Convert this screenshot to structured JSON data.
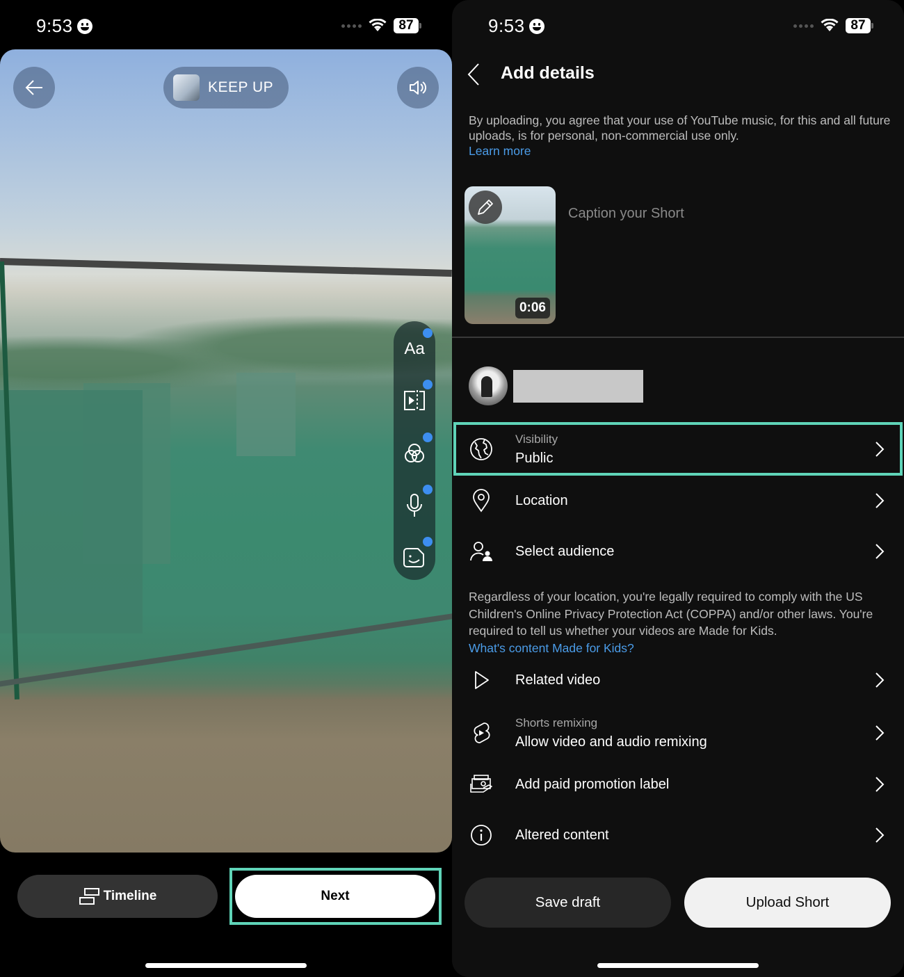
{
  "left_screen": {
    "status_bar": {
      "time": "9:53",
      "battery": "87"
    },
    "top_controls": {
      "back_icon": "arrow-left-icon",
      "music_track": "KEEP UP",
      "sound_icon": "speaker-icon"
    },
    "side_tools": [
      {
        "name": "text",
        "label": "Aa",
        "icon": "text-icon",
        "has_dot": true
      },
      {
        "name": "trim",
        "icon": "trim-icon",
        "has_dot": true
      },
      {
        "name": "filters",
        "icon": "filters-icon",
        "has_dot": true
      },
      {
        "name": "voiceover",
        "icon": "microphone-icon",
        "has_dot": true
      },
      {
        "name": "sticker",
        "icon": "sticker-icon",
        "has_dot": true
      }
    ],
    "bottom": {
      "timeline_label": "Timeline",
      "next_label": "Next"
    }
  },
  "right_screen": {
    "status_bar": {
      "time": "9:53",
      "battery": "87"
    },
    "header": {
      "title": "Add details"
    },
    "disclaimer": {
      "text": "By uploading, you agree that your use of YouTube music, for this and all future uploads, is for personal, non-commercial use only.",
      "link": "Learn more"
    },
    "thumbnail": {
      "duration": "0:06"
    },
    "caption_placeholder": "Caption your Short",
    "settings": [
      {
        "id": "visibility",
        "icon": "globe-icon",
        "sublabel": "Visibility",
        "label": "Public",
        "highlighted": true
      },
      {
        "id": "location",
        "icon": "location-pin-icon",
        "label": "Location"
      },
      {
        "id": "audience",
        "icon": "audience-icon",
        "label": "Select audience"
      }
    ],
    "coppa": {
      "text": "Regardless of your location, you're legally required to comply with the US Children's Online Privacy Protection Act (COPPA) and/or other laws. You're required to tell us whether your videos are Made for Kids.",
      "link": "What's content Made for Kids?"
    },
    "settings_more": [
      {
        "id": "related-video",
        "icon": "play-outline-icon",
        "label": "Related video"
      },
      {
        "id": "remixing",
        "icon": "shorts-icon",
        "sublabel": "Shorts remixing",
        "label": "Allow video and audio remixing"
      },
      {
        "id": "paid-promotion",
        "icon": "paid-promotion-icon",
        "label": "Add paid promotion label"
      },
      {
        "id": "altered-content",
        "icon": "info-icon",
        "label": "Altered content"
      }
    ],
    "buttons": {
      "save_draft": "Save draft",
      "upload": "Upload Short"
    }
  },
  "colors": {
    "highlight": "#5fd4b8",
    "link": "#4b9ce8",
    "badge_dot": "#3d8ef0",
    "background_dark": "#0f0f0f"
  }
}
